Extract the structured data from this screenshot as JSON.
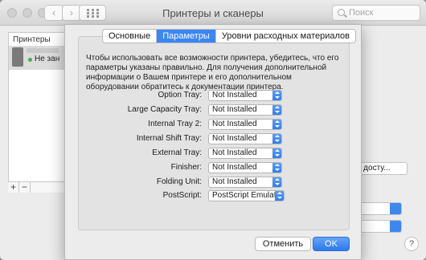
{
  "window": {
    "title": "Принтеры и сканеры",
    "search_placeholder": "Поиск"
  },
  "printers_panel": {
    "label": "Принтеры",
    "printer_status": "Не зан"
  },
  "background": {
    "share_button_label": "щий досту...",
    "help_label": "?"
  },
  "dialog": {
    "tabs": [
      {
        "label": "Основные",
        "active": false
      },
      {
        "label": "Параметры",
        "active": true
      },
      {
        "label": "Уровни расходных материалов",
        "active": false
      }
    ],
    "info_text": "Чтобы использовать все возможности принтера, убедитесь, что его параметры указаны правильно. Для получения дополнительной информации о Вашем принтере и его дополнительном оборудовании обратитесь к документации принтера.",
    "options": [
      {
        "label": "Option Tray:",
        "value": "Not Installed"
      },
      {
        "label": "Large Capacity Tray:",
        "value": "Not Installed"
      },
      {
        "label": "Internal Tray 2:",
        "value": "Not Installed"
      },
      {
        "label": "Internal Shift Tray:",
        "value": "Not Installed"
      },
      {
        "label": "External Tray:",
        "value": "Not Installed"
      },
      {
        "label": "Finisher:",
        "value": "Not Installed"
      },
      {
        "label": "Folding Unit:",
        "value": "Not Installed"
      },
      {
        "label": "PostScript:",
        "value": "PostScript Emulation"
      }
    ],
    "cancel_label": "Отменить",
    "ok_label": "OK"
  },
  "colors": {
    "accent": "#3a86f5",
    "status_ok": "#3ab54a"
  }
}
